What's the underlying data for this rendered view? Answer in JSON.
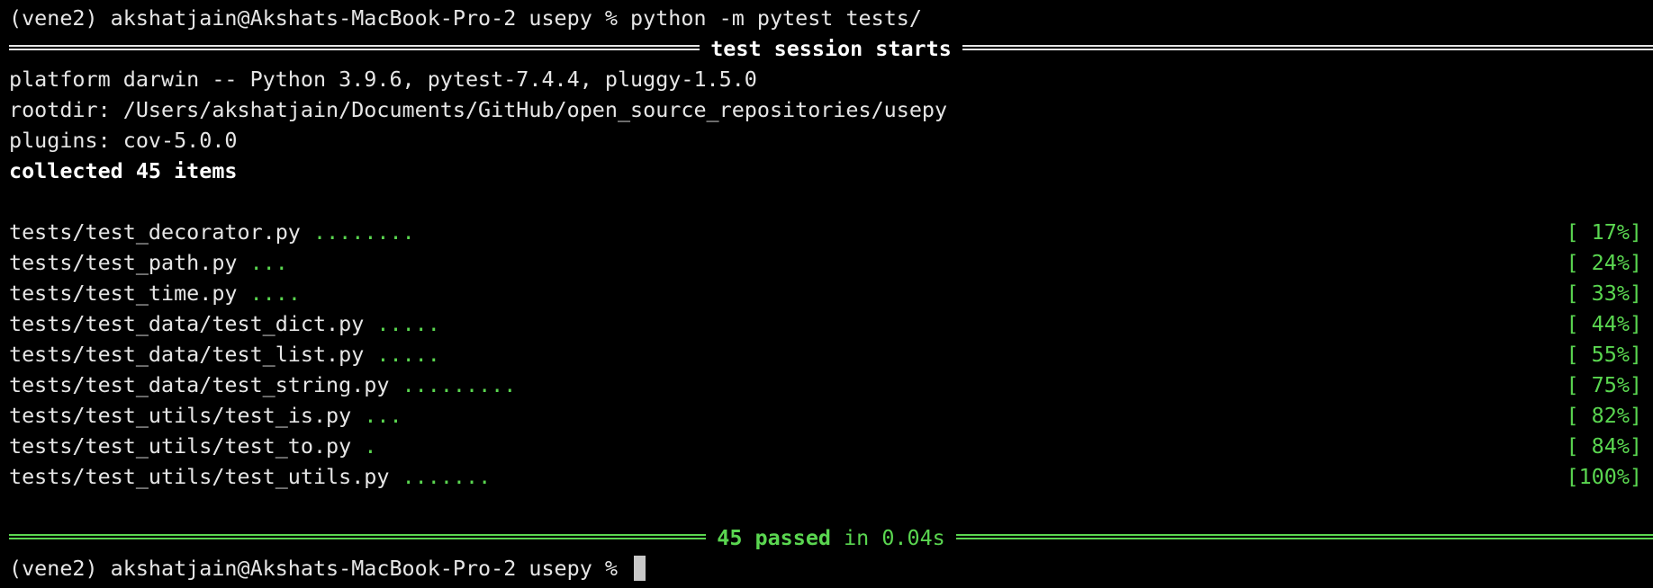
{
  "prompt": "(vene2) akshatjain@Akshats-MacBook-Pro-2 usepy % ",
  "command": "python -m pytest tests/",
  "session_header": "test session starts",
  "info_lines": [
    "platform darwin -- Python 3.9.6, pytest-7.4.4, pluggy-1.5.0",
    "rootdir: /Users/akshatjain/Documents/GitHub/open_source_repositories/usepy",
    "plugins: cov-5.0.0"
  ],
  "collected": "collected 45 items",
  "results": [
    {
      "file": "tests/test_decorator.py",
      "dots": "........",
      "progress": "[ 17%]"
    },
    {
      "file": "tests/test_path.py",
      "dots": "...",
      "progress": "[ 24%]"
    },
    {
      "file": "tests/test_time.py",
      "dots": "....",
      "progress": "[ 33%]"
    },
    {
      "file": "tests/test_data/test_dict.py",
      "dots": ".....",
      "progress": "[ 44%]"
    },
    {
      "file": "tests/test_data/test_list.py",
      "dots": ".....",
      "progress": "[ 55%]"
    },
    {
      "file": "tests/test_data/test_string.py",
      "dots": ".........",
      "progress": "[ 75%]"
    },
    {
      "file": "tests/test_utils/test_is.py",
      "dots": "...",
      "progress": "[ 82%]"
    },
    {
      "file": "tests/test_utils/test_to.py",
      "dots": ".",
      "progress": "[ 84%]"
    },
    {
      "file": "tests/test_utils/test_utils.py",
      "dots": ".......",
      "progress": "[100%]"
    }
  ],
  "summary": {
    "passed": "45 passed",
    "in_time": " in 0.04s"
  },
  "colors": {
    "background": "#000000",
    "foreground": "#e6e6e6",
    "success": "#5ad650"
  }
}
